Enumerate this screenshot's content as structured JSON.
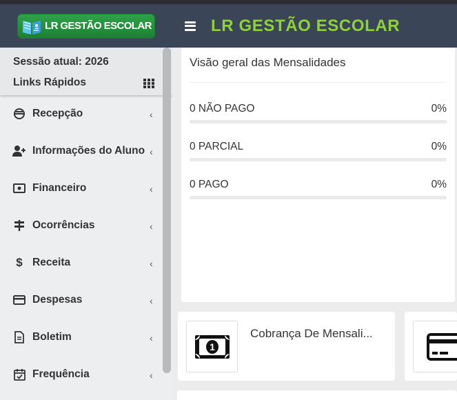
{
  "header": {
    "logo_text": "LR GESTÃO ESCOLAR",
    "title": "LR GESTÃO ESCOLAR",
    "accent_color": "#8fd13a",
    "bar_color": "#3a4658"
  },
  "sidebar": {
    "session": "Sessão atual: 2026",
    "quick_links": "Links Rápidos",
    "items": [
      {
        "label": "Recepção",
        "icon": "reception-icon"
      },
      {
        "label": "Informações do Aluno",
        "icon": "user-plus-icon"
      },
      {
        "label": "Financeiro",
        "icon": "money-bill-icon"
      },
      {
        "label": "Ocorrências",
        "icon": "signpost-icon"
      },
      {
        "label": "Receita",
        "icon": "dollar-icon"
      },
      {
        "label": "Despesas",
        "icon": "credit-card-icon"
      },
      {
        "label": "Boletim",
        "icon": "document-icon"
      },
      {
        "label": "Frequência",
        "icon": "calendar-check-icon"
      }
    ]
  },
  "overview": {
    "title": "Visão geral das Mensalidades",
    "stats": [
      {
        "label": "0 NÃO PAGO",
        "percent_text": "0%",
        "percent": 0
      },
      {
        "label": "0 PARCIAL",
        "percent_text": "0%",
        "percent": 0
      },
      {
        "label": "0 PAGO",
        "percent_text": "0%",
        "percent": 0
      }
    ]
  },
  "tiles": [
    {
      "label": "Cobrança De Mensali...",
      "icon": "money-bill-icon"
    },
    {
      "label": "",
      "icon": "credit-card-icon"
    }
  ]
}
